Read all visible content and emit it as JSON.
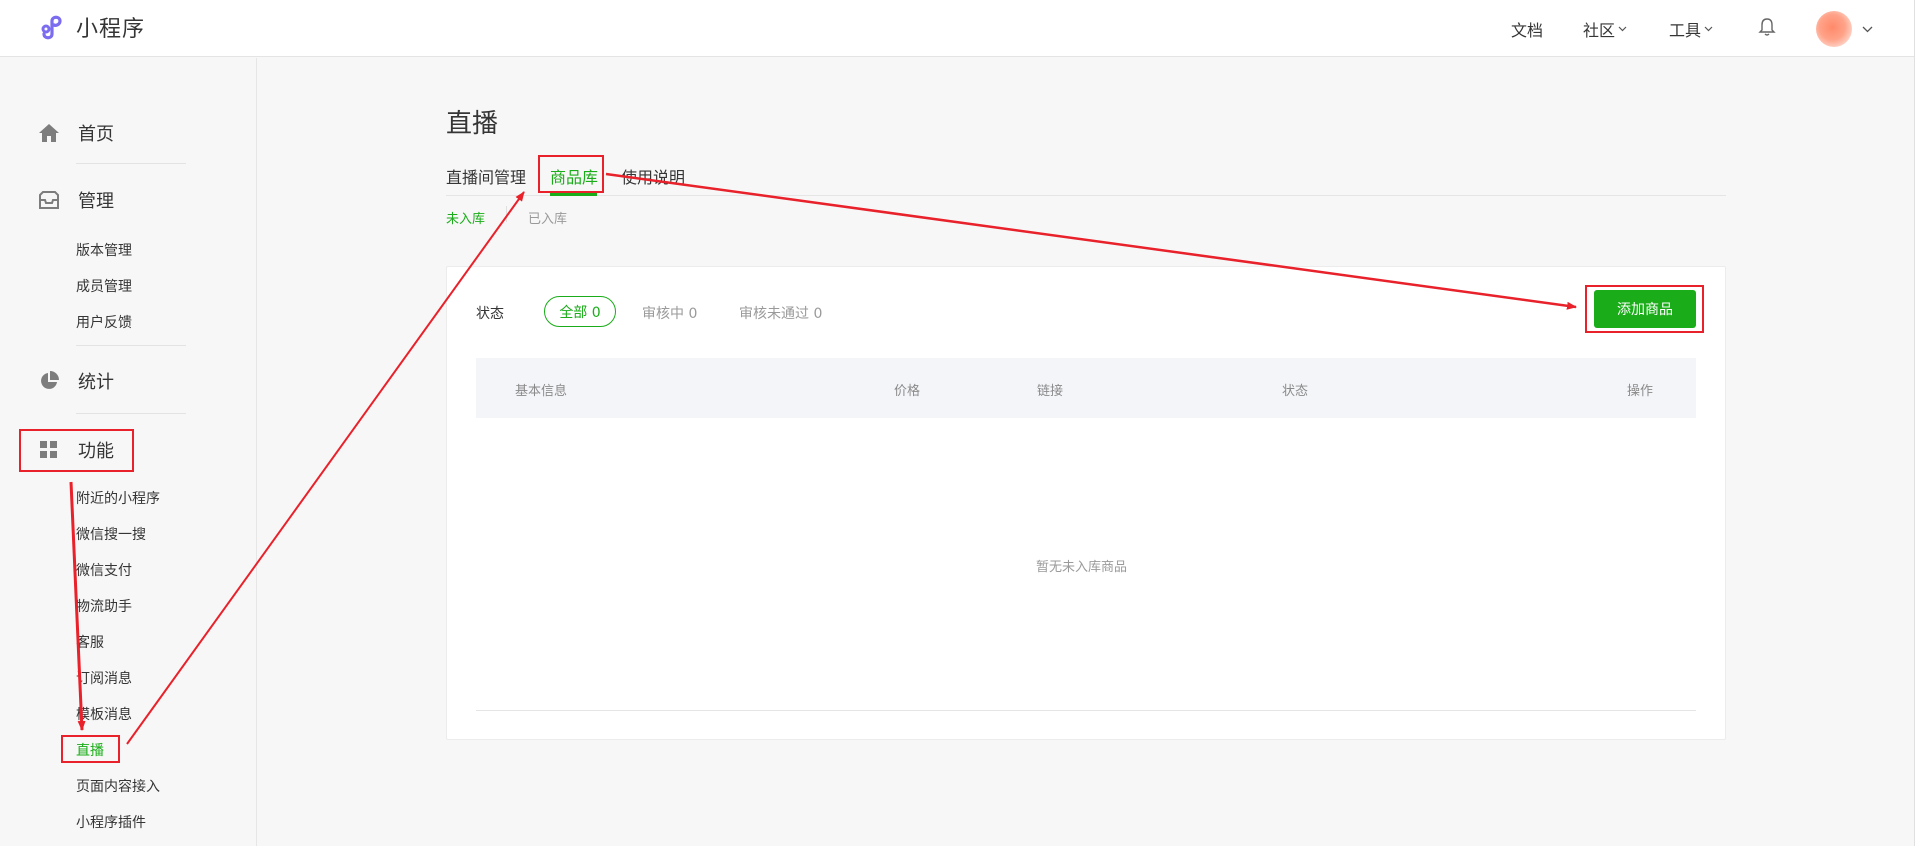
{
  "app": {
    "name": "小程序",
    "brand_color": "#1aad19",
    "annotation_color": "#e8212a"
  },
  "topbar": {
    "docs": "文档",
    "community": "社区",
    "tools": "工具",
    "icons": [
      "logo-icon",
      "bell-icon",
      "avatar",
      "chevron-down-icon"
    ]
  },
  "sidebar": {
    "groups": [
      {
        "label": "首页",
        "icon": "home-icon"
      },
      {
        "label": "管理",
        "icon": "inbox-icon",
        "items": [
          "版本管理",
          "成员管理",
          "用户反馈"
        ]
      },
      {
        "label": "统计",
        "icon": "pie-chart-icon"
      },
      {
        "label": "功能",
        "icon": "grid-icon",
        "items": [
          "附近的小程序",
          "微信搜一搜",
          "微信支付",
          "物流助手",
          "客服",
          "订阅消息",
          "模板消息",
          "直播",
          "页面内容接入",
          "小程序插件"
        ]
      }
    ],
    "active_item": "直播"
  },
  "main": {
    "title": "直播",
    "tabs": [
      "直播间管理",
      "商品库",
      "使用说明"
    ],
    "active_tab": "商品库",
    "subtabs": [
      "未入库",
      "已入库"
    ],
    "active_subtab": "未入库",
    "status_label": "状态",
    "filters": [
      "全部 0",
      "审核中 0",
      "审核未通过 0"
    ],
    "active_filter": "全部 0",
    "add_button": "添加商品",
    "table": {
      "columns": [
        "基本信息",
        "价格",
        "链接",
        "状态",
        "操作"
      ],
      "empty_text": "暂无未入库商品"
    }
  }
}
